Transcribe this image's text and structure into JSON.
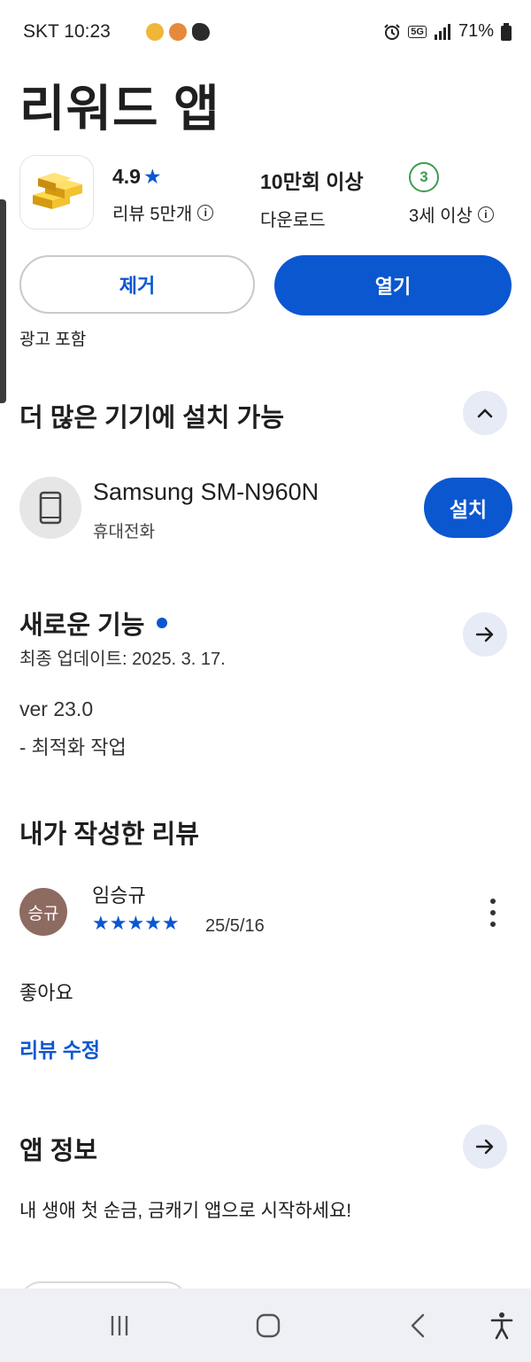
{
  "status_bar": {
    "carrier_time": "SKT 10:23",
    "battery": "71%",
    "network": "5G"
  },
  "app": {
    "title": "리워드 앱",
    "rating": "4.9",
    "rating_star": "★",
    "reviews_label": "리뷰 5만개",
    "downloads_value": "10만회 이상",
    "downloads_label": "다운로드",
    "age_badge": "3",
    "age_label": "3세 이상",
    "uninstall_label": "제거",
    "open_label": "열기",
    "ads_note": "광고 포함"
  },
  "devices_section": {
    "title": "더 많은 기기에 설치 가능",
    "device_name": "Samsung SM-N960N",
    "device_type": "휴대전화",
    "install_label": "설치"
  },
  "whats_new": {
    "title": "새로운 기능",
    "updated": "최종 업데이트: 2025. 3. 17.",
    "version": "ver 23.0",
    "notes": "- 최적화 작업"
  },
  "my_review": {
    "title": "내가 작성한 리뷰",
    "avatar_text": "승규",
    "reviewer": "임승규",
    "stars_text": "★★★★★",
    "rating_value": 5,
    "date": "25/5/16",
    "body": "좋아요",
    "edit_label": "리뷰 수정"
  },
  "about": {
    "title": "앱 정보",
    "description": "내 생애 첫 순금, 금캐기 앱으로 시작하세요!"
  },
  "colors": {
    "accent": "#0b57d0",
    "age_green": "#3f9b4f",
    "avatar_brown": "#8d6b61"
  }
}
